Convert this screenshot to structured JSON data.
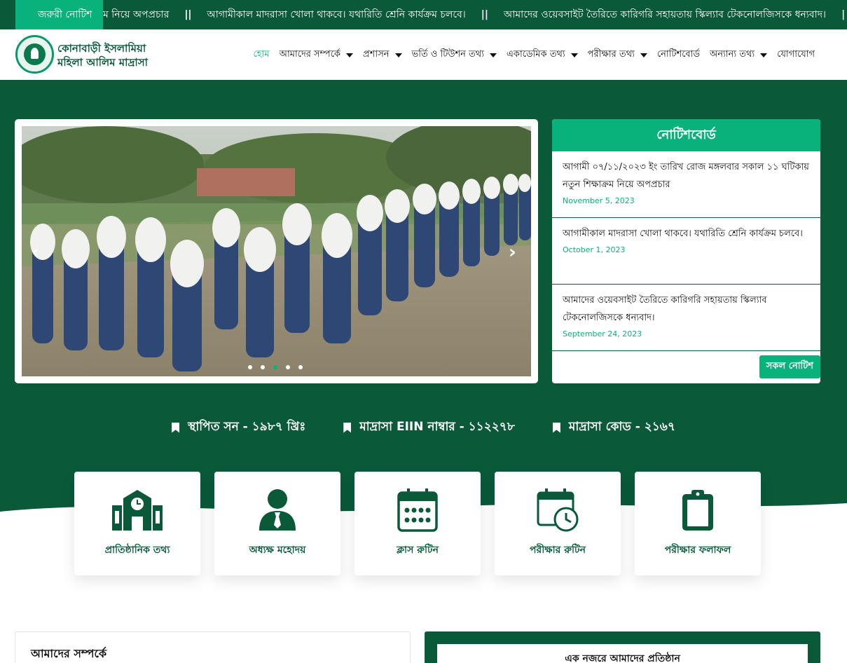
{
  "ticker": {
    "label": "জরুরী নোটিশ",
    "items": [
      "ম নিয়ে অপপ্রচার",
      "আগামীকাল মাদরাসা খোলা থাকবে। যথারিতি শ্রেনি কার্যক্রম চলবে।",
      "আমাদের ওয়েবসাইট তৈরিতে কারিগরি সহায়তায় স্কিল্যাব টেকনোলজিসকে ধন্যবাদ।"
    ],
    "separator": "||",
    "end_separator": "|"
  },
  "header": {
    "site_name_line1": "কোনাবাড়ী ইসলামিয়া",
    "site_name_line2": "মহিলা আলিম মাদ্রাসা",
    "nav": [
      {
        "label": "হোম",
        "active": true,
        "dropdown": false
      },
      {
        "label": "আমাদের সম্পর্কে",
        "active": false,
        "dropdown": true
      },
      {
        "label": "প্রশাসন",
        "active": false,
        "dropdown": true
      },
      {
        "label": "ভর্তি ও টিউশন তথ্য",
        "active": false,
        "dropdown": true
      },
      {
        "label": "একাডেমিক তথ্য",
        "active": false,
        "dropdown": true
      },
      {
        "label": "পরীক্ষার তথ্য",
        "active": false,
        "dropdown": true
      },
      {
        "label": "নোটিশবোর্ড",
        "active": false,
        "dropdown": false
      },
      {
        "label": "অন্যান্য তথ্য",
        "active": false,
        "dropdown": true
      },
      {
        "label": "যোগাযোগ",
        "active": false,
        "dropdown": false
      }
    ]
  },
  "slider": {
    "prev_icon": "chevron-left-icon",
    "next_icon": "chevron-right-icon",
    "slide_count": 5,
    "active_index": 2
  },
  "noticeboard": {
    "title": "নোটিশবোর্ড",
    "items": [
      {
        "title": "আগামী ০৭/১১/২০২৩ ইং তারিখ রোজ মঙ্গলবার সকাল ১১ ঘটিকায় নতুন শিক্ষাক্রম নিয়ে অপপ্রচার",
        "date": "November 5, 2023"
      },
      {
        "title": "আগামীকাল মাদরাসা খোলা থাকবে। যথারিতি শ্রেনি কার্যক্রম চলবে।",
        "date": "October 1, 2023"
      },
      {
        "title": "আমাদের ওয়েবসাইট তৈরিতে কারিগরি সহায়তায় স্কিল্যাব টেকনোলজিসকে ধন্যবাদ।",
        "date": "September 24, 2023"
      }
    ],
    "all_button": "সকল নোটিশ"
  },
  "facts": [
    "স্থাপিত সন - ১৯৮৭ খ্রিঃ",
    "মাদ্রাসা EIIN নাম্বার - ১১২২৭৮",
    "মাদ্রাসা কোড - ২১৬৭"
  ],
  "cards": [
    {
      "label": "প্রাতিষ্ঠানিক তথ্য",
      "icon": "school-icon"
    },
    {
      "label": "অধ্যক্ষ মহোদয়",
      "icon": "user-tie-icon"
    },
    {
      "label": "ক্লাস রুটিন",
      "icon": "calendar-icon"
    },
    {
      "label": "পরীক্ষার রুটিন",
      "icon": "calendar-clock-icon"
    },
    {
      "label": "পরীক্ষার ফলাফল",
      "icon": "clipboard-icon"
    }
  ],
  "sections": {
    "about_title": "আমাদের সম্পর্কে",
    "glance_title": "এক নজরে আমাদের প্রতিষ্ঠান"
  },
  "colors": {
    "primary_dark": "#0a5a3a",
    "accent": "#08b27a"
  }
}
